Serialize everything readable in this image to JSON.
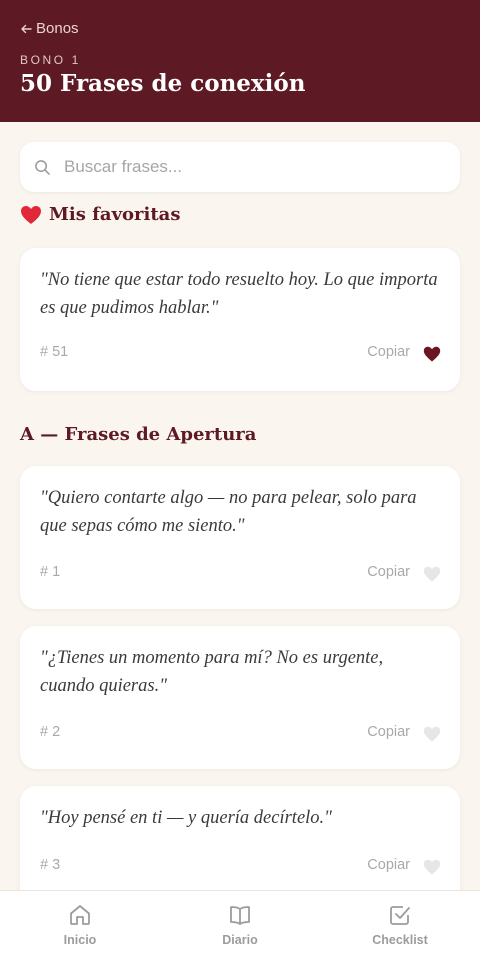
{
  "header": {
    "back_label": "Bonos",
    "eyebrow": "BONO 1",
    "title": "50 Frases de conexión"
  },
  "search": {
    "placeholder": "Buscar frases..."
  },
  "favorites": {
    "title": "Mis favoritas",
    "cards": [
      {
        "quote": "\"No tiene que estar todo resuelto hoy. Lo que importa es que pudimos hablar.\"",
        "number": "# 51",
        "copy_label": "Copiar",
        "favorited": true
      }
    ]
  },
  "section_a": {
    "title": "A — Frases de Apertura",
    "cards": [
      {
        "quote": "\"Quiero contarte algo — no para pelear, solo para que sepas cómo me siento.\"",
        "number": "# 1",
        "copy_label": "Copiar",
        "favorited": false
      },
      {
        "quote": "\"¿Tienes un momento para mí? No es urgente, cuando quieras.\"",
        "number": "# 2",
        "copy_label": "Copiar",
        "favorited": false
      },
      {
        "quote": "\"Hoy pensé en ti — y quería decírtelo.\"",
        "number": "# 3",
        "copy_label": "Copiar",
        "favorited": false
      }
    ]
  },
  "bottom_nav": {
    "items": [
      {
        "label": "Inicio",
        "icon": "home-icon"
      },
      {
        "label": "Diario",
        "icon": "book-icon"
      },
      {
        "label": "Checklist",
        "icon": "checklist-icon"
      }
    ]
  },
  "colors": {
    "brand": "#5e1a24",
    "background": "#fbf5ef",
    "heart_active": "#6b1520",
    "heart_inactive": "#e6e6e6"
  }
}
